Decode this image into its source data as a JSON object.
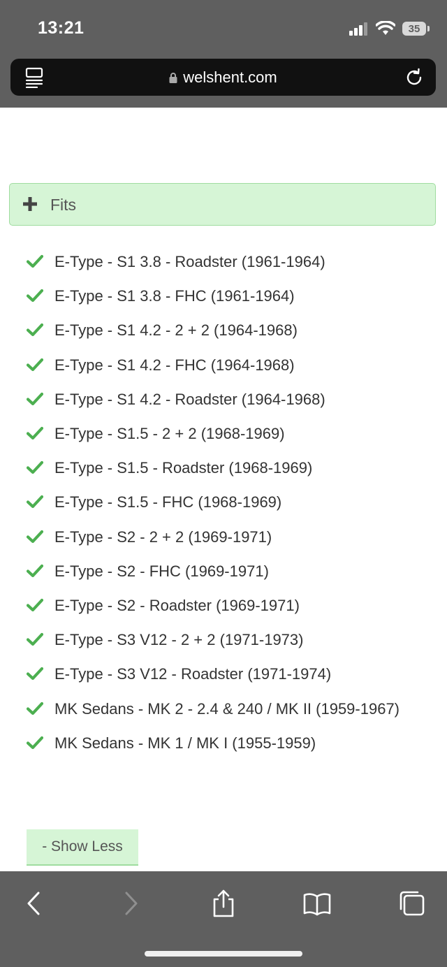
{
  "status_bar": {
    "time": "13:21",
    "battery": "35"
  },
  "browser": {
    "url": "welshent.com"
  },
  "fits": {
    "header_label": "Fits",
    "items": [
      "E-Type - S1 3.8 - Roadster (1961-1964)",
      "E-Type - S1 3.8 - FHC (1961-1964)",
      "E-Type - S1 4.2 - 2 + 2 (1964-1968)",
      "E-Type - S1 4.2 - FHC (1964-1968)",
      "E-Type - S1 4.2 - Roadster (1964-1968)",
      "E-Type - S1.5 - 2 + 2 (1968-1969)",
      "E-Type - S1.5 - Roadster (1968-1969)",
      "E-Type - S1.5 - FHC (1968-1969)",
      "E-Type - S2 - 2 + 2 (1969-1971)",
      "E-Type - S2 - FHC (1969-1971)",
      "E-Type - S2 - Roadster (1969-1971)",
      "E-Type - S3 V12 - 2 + 2 (1971-1973)",
      "E-Type - S3 V12 - Roadster (1971-1974)",
      "MK Sedans - MK 2 - 2.4 & 240 / MK II (1959-1967)",
      "MK Sedans - MK 1 / MK I (1955-1959)"
    ],
    "show_less_label": "- Show Less"
  },
  "colors": {
    "accent_green": "#4caf50",
    "panel_green": "#d6f5d6",
    "chrome_gray": "#5f5f5f"
  }
}
